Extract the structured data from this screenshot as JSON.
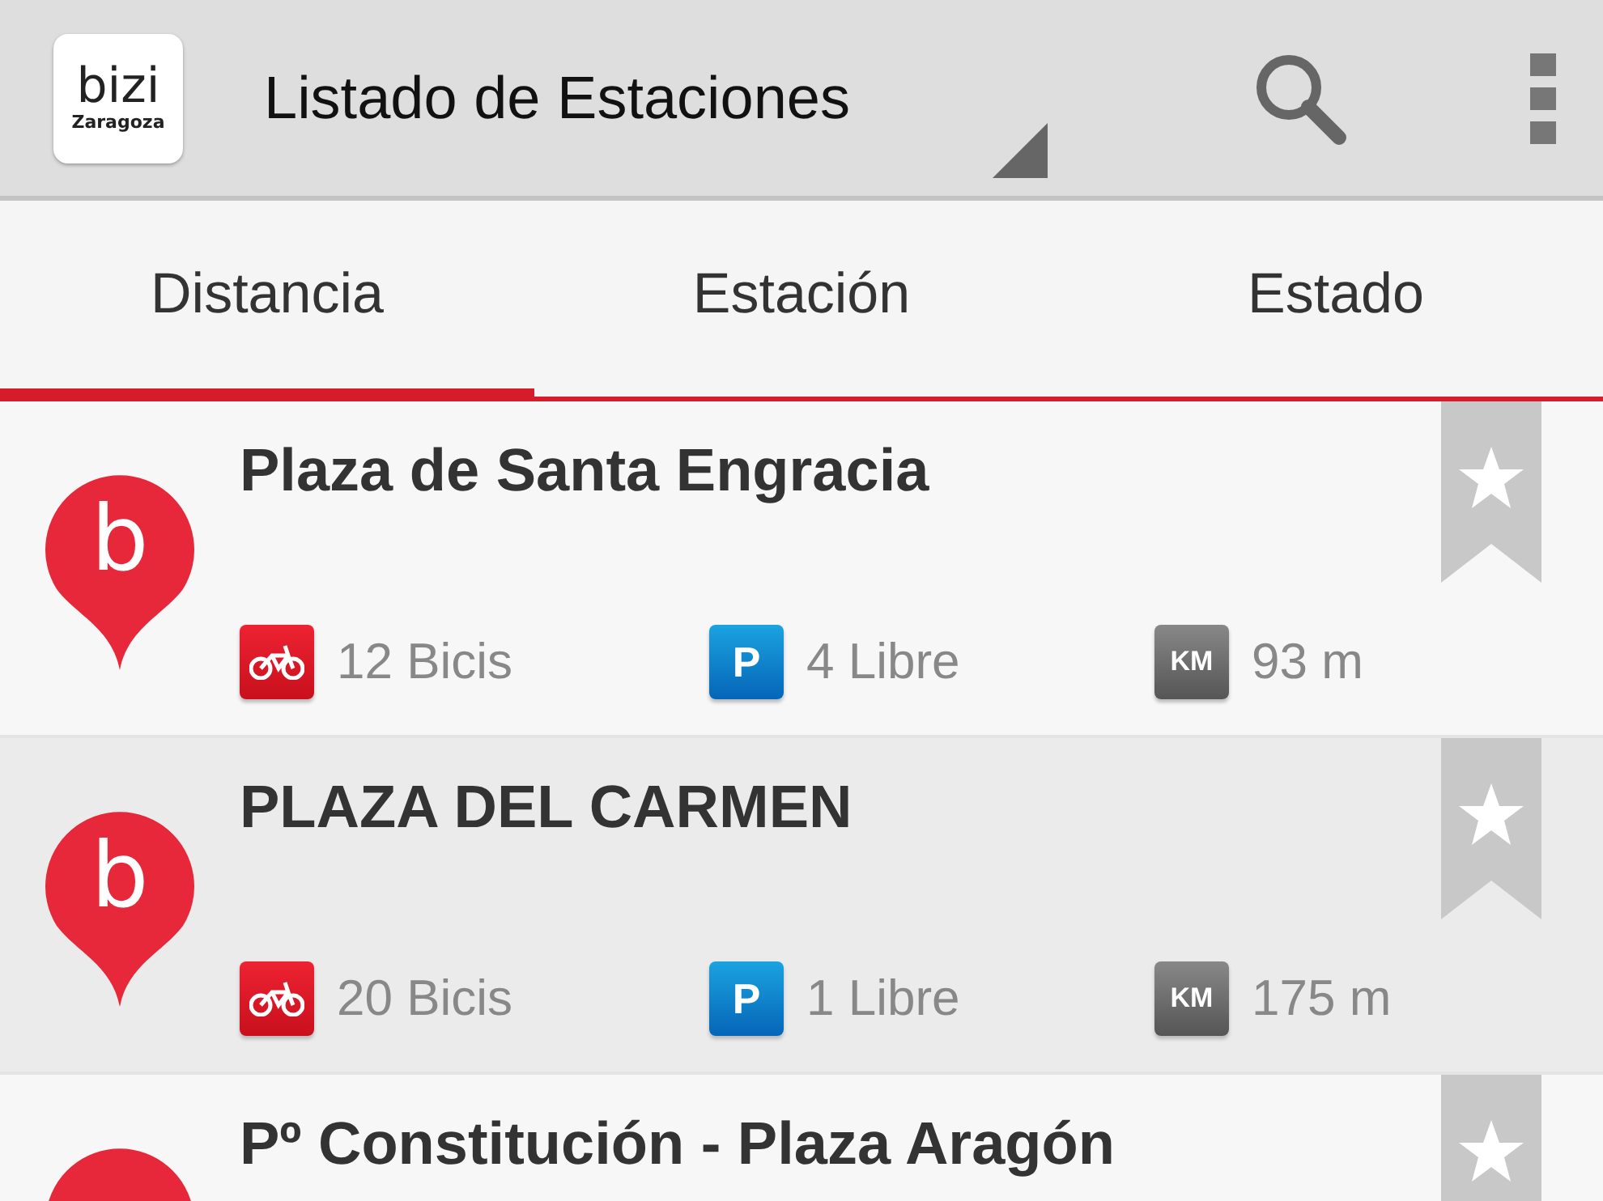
{
  "app_bar": {
    "logo_text": "bizi",
    "logo_subtext": "Zaragoza",
    "title": "Listado de Estaciones"
  },
  "tabs": [
    {
      "label": "Distancia",
      "selected": true
    },
    {
      "label": "Estación",
      "selected": false
    },
    {
      "label": "Estado",
      "selected": false
    }
  ],
  "stations": [
    {
      "pin_letter": "b",
      "name": "Plaza de Santa Engracia",
      "highlighted": false,
      "favorite": false,
      "stats": [
        {
          "kind": "bikes",
          "text": "12 Bicis"
        },
        {
          "kind": "parking",
          "badge": "P",
          "text": "4 Libre"
        },
        {
          "kind": "distance",
          "badge": "KM",
          "text": "93 m"
        }
      ]
    },
    {
      "pin_letter": "b",
      "name": "PLAZA DEL CARMEN",
      "highlighted": true,
      "favorite": false,
      "stats": [
        {
          "kind": "bikes",
          "text": "20 Bicis"
        },
        {
          "kind": "parking",
          "badge": "P",
          "text": "1 Libre"
        },
        {
          "kind": "distance",
          "badge": "KM",
          "text": "175 m"
        }
      ]
    },
    {
      "name": "Pº Constitución - Plaza Aragón",
      "highlighted": false,
      "favorite": false
    }
  ]
}
